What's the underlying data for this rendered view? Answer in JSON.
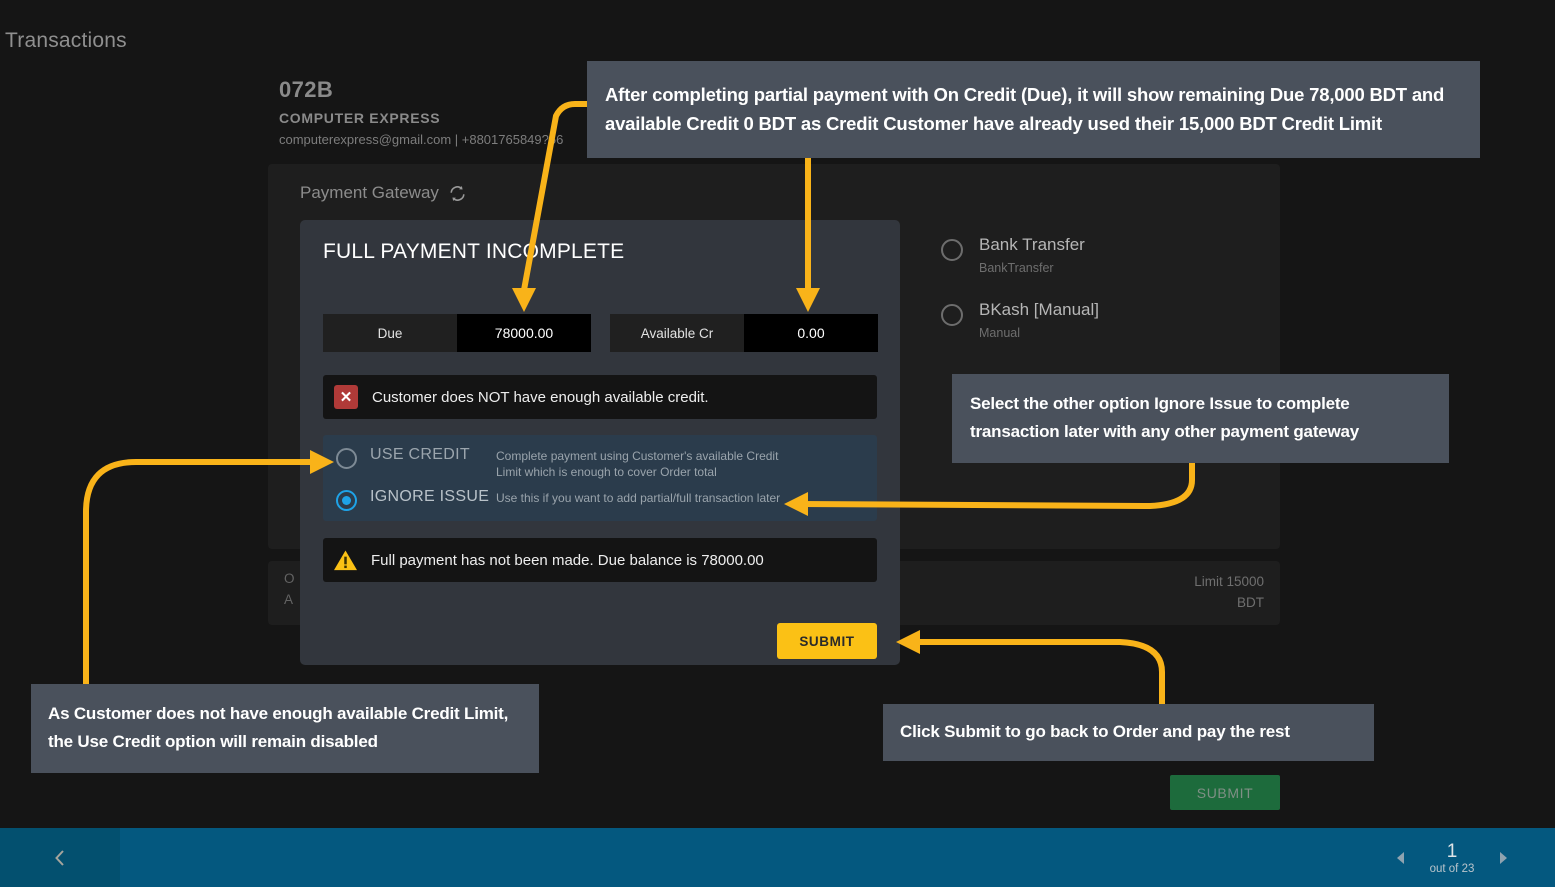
{
  "page": {
    "title": "Transactions"
  },
  "customer": {
    "code": "072B",
    "name": "COMPUTER EXPRESS",
    "contact": "computerexpress@gmail.com | +8801765849?56"
  },
  "gateway": {
    "label": "Payment Gateway",
    "refresh_icon": "refresh-icon",
    "options": [
      {
        "title": "Bank Transfer",
        "sub": "BankTransfer"
      },
      {
        "title": "BKash [Manual]",
        "sub": "Manual"
      }
    ]
  },
  "credit_card": {
    "line1": "O",
    "line2": "A",
    "limit_line1": "Limit 15000",
    "limit_line2": "BDT"
  },
  "dialog": {
    "title": "FULL PAYMENT INCOMPLETE",
    "amounts": [
      {
        "label": "Due",
        "value": "78000.00"
      },
      {
        "label": "Available Cr",
        "value": "0.00"
      }
    ],
    "error": {
      "icon": "error-x-icon",
      "text": "Customer does NOT have enough available credit."
    },
    "choices": [
      {
        "name": "USE CREDIT",
        "desc": "Complete payment using Customer's available Credit Limit which is enough to cover Order total",
        "selected": false
      },
      {
        "name": "IGNORE ISSUE",
        "desc": "Use this if you want to add partial/full transaction later",
        "selected": true
      }
    ],
    "warning": {
      "icon": "warning-triangle-icon",
      "text": "Full payment has not been made. Due balance is 78000.00"
    },
    "submit_label": "SUBMIT"
  },
  "page_submit_label": "SUBMIT",
  "bottom_bar": {
    "back_icon": "chevron-left-icon",
    "prev_icon": "triangle-left-icon",
    "next_icon": "triangle-right-icon",
    "page_number": "1",
    "page_of": "out of 23"
  },
  "annotations": {
    "top": "After completing partial payment with On Credit (Due), it will show remaining Due 78,000 BDT and available Credit 0 BDT as Credit Customer have already used their 15,000 BDT Credit Limit",
    "right": "Select the other option Ignore Issue to complete transaction later with any other payment gateway",
    "left": "As Customer does not have enough available Credit Limit, the Use Credit option will remain disabled",
    "bottom": "Click Submit to go back to Order and pay the rest"
  },
  "colors": {
    "accent_arrow": "#f9b319",
    "dialog_submit": "#fbc115",
    "page_submit": "#1d6b3c",
    "bottom_bar": "#04587f",
    "radio_selected": "#1ea3e8",
    "error": "#b03a38"
  }
}
